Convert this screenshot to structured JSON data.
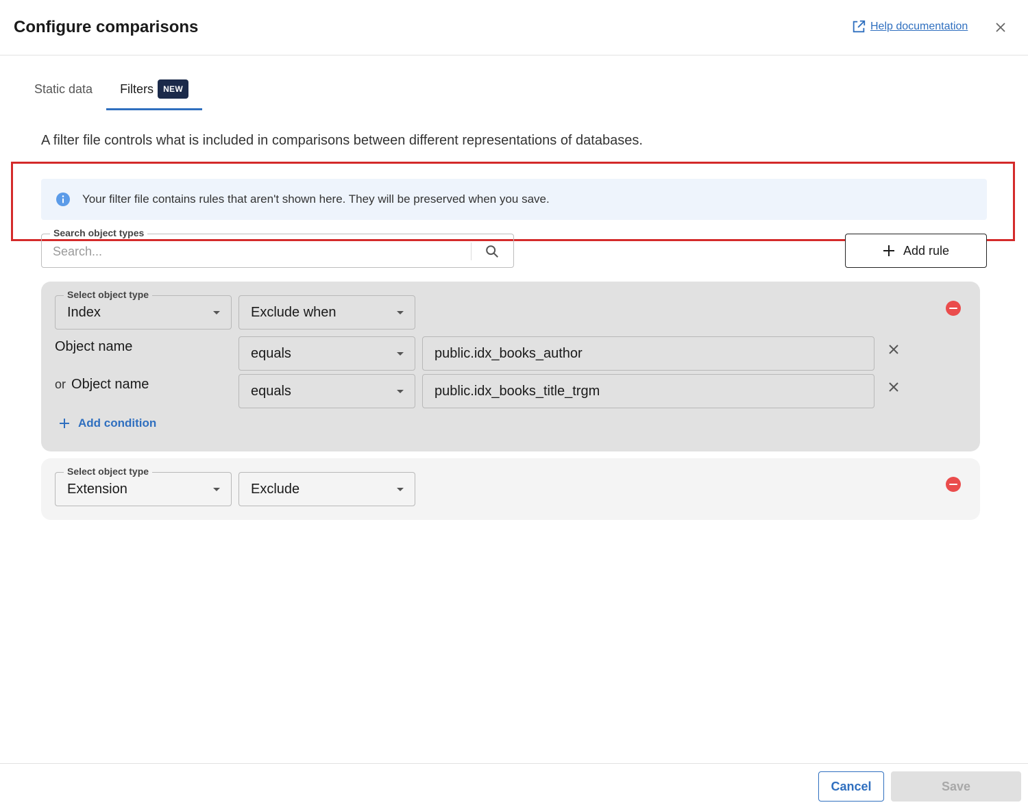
{
  "dialog": {
    "title": "Configure comparisons",
    "help_link": "Help documentation",
    "close_icon": "close-icon",
    "external_link_icon": "external-link-icon"
  },
  "tabs": [
    {
      "label": "Static data",
      "active": false
    },
    {
      "label": "Filters",
      "active": true,
      "badge": "NEW"
    }
  ],
  "description": "A filter file controls what is included in comparisons between different representations of databases.",
  "info_banner": {
    "icon": "info-icon",
    "text": "Your filter file contains rules that aren't shown here. They will be preserved when you save."
  },
  "search": {
    "label": "Search object types",
    "placeholder": "Search...",
    "icon": "search-icon"
  },
  "add_rule_label": "Add rule",
  "rules": [
    {
      "object_type_label": "Select object type",
      "object_type": "Index",
      "mode": "Exclude when",
      "conditions": [
        {
          "prefix": "",
          "field": "Object name",
          "operator": "equals",
          "value": "public.idx_books_author"
        },
        {
          "prefix": "or",
          "field": "Object name",
          "operator": "equals",
          "value": "public.idx_books_title_trgm"
        }
      ],
      "add_condition_label": "Add condition"
    },
    {
      "object_type_label": "Select object type",
      "object_type": "Extension",
      "mode": "Exclude"
    }
  ],
  "footer": {
    "cancel_label": "Cancel",
    "save_label": "Save"
  },
  "colors": {
    "accent": "#2f6fbf",
    "badge_bg": "#1b2a4a",
    "remove": "#ea4c4c",
    "highlight": "#d42a2a",
    "info_bg": "#eef4fc"
  }
}
